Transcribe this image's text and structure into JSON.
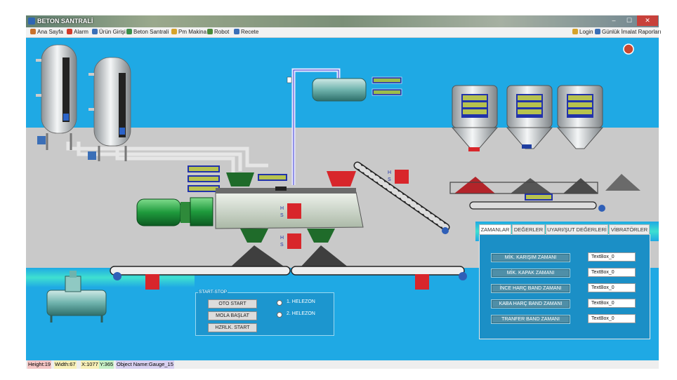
{
  "window": {
    "title": "BETON SANTRALİ",
    "minimize": "–",
    "maximize": "☐",
    "close": "✕"
  },
  "menu": {
    "left": [
      {
        "label": "Ana Sayfa",
        "icon": "home-icon",
        "color": "#c9722c"
      },
      {
        "label": "Alarm",
        "icon": "alarm-icon",
        "color": "#d23b2b"
      },
      {
        "label": "Ürün Girişi",
        "icon": "product-entry-icon",
        "color": "#3b6fb7"
      },
      {
        "label": "Beton Santrali",
        "icon": "concrete-plant-icon",
        "color": "#3b8f4a"
      },
      {
        "label": "Pm Makina",
        "icon": "machine-icon",
        "color": "#d6a32b"
      },
      {
        "label": "Robot",
        "icon": "robot-icon",
        "color": "#4a8a3a"
      },
      {
        "label": "Recete",
        "icon": "recipe-icon",
        "color": "#3b6fb7"
      }
    ],
    "right": [
      {
        "label": "Login",
        "icon": "key-icon",
        "color": "#d6a32b"
      },
      {
        "label": "Günlük İmalat Raporları",
        "icon": "report-icon",
        "color": "#3b6fb7"
      }
    ]
  },
  "process": {
    "h_label": "H",
    "s_label": "S"
  },
  "tabs": [
    "ZAMANLAR",
    "DEĞERLER",
    "UYARI/ŞUT DEĞERLERİ",
    "VİBRATÖRLER"
  ],
  "timers": [
    {
      "label": "MİK. KARIŞIM ZAMANI",
      "value": "TextBox_0"
    },
    {
      "label": "MİK. KAPAK ZAMANI",
      "value": "TextBox_0"
    },
    {
      "label": "İNCE HARÇ BAND ZAMANI",
      "value": "TextBox_0"
    },
    {
      "label": "KABA HARÇ BAND ZAMANI",
      "value": "TextBox_0"
    },
    {
      "label": "TRANFER BAND ZAMANI",
      "value": "TextBox_0"
    }
  ],
  "start_stop": {
    "title": "START-STOP",
    "buttons": [
      "OTO START",
      "MOLA BAŞLAT",
      "HZRLK. START"
    ],
    "options": [
      "1. HELEZON",
      "2. HELEZON"
    ]
  },
  "status": {
    "height": "Height:19",
    "width": "Width:67",
    "x": "X:1077",
    "y": "Y:365",
    "object": "Object Name:Gauge_15"
  },
  "colors": {
    "background": "#1fa9e4",
    "floor": "#c9c9c9",
    "accent_red": "#d8262b",
    "mixer": "#cfd8cc",
    "motor": "#2aa14a"
  }
}
